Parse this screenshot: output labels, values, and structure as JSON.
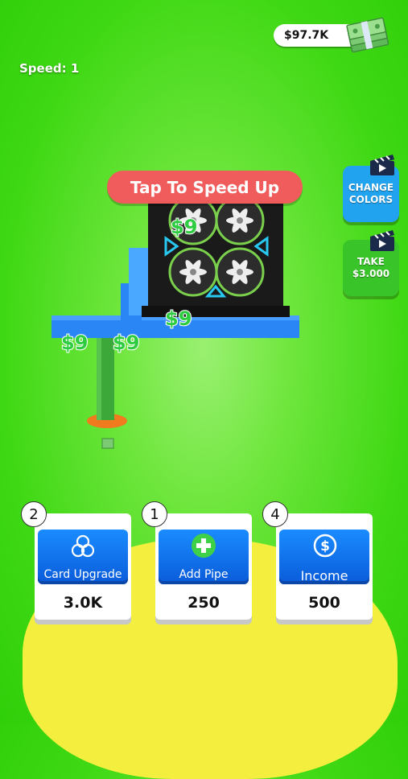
{
  "hud": {
    "money": "$97.7K",
    "speed": "Speed: 1"
  },
  "side_buttons": {
    "change_colors": [
      "CHANGE",
      "COLORS"
    ],
    "take": [
      "TAKE",
      "$3.000"
    ]
  },
  "banner": "Tap To Speed Up",
  "floating_money": [
    "$9",
    "$9",
    "$9",
    "$9"
  ],
  "upgrades": [
    {
      "badge": "2",
      "label": "Card Upgrade",
      "price": "3.0K",
      "icon": "triangle-rings-icon"
    },
    {
      "badge": "1",
      "label": "Add Pipe",
      "price": "250",
      "icon": "plus-icon"
    },
    {
      "badge": "4",
      "label": "Income",
      "price": "500",
      "icon": "dollar-coin-icon"
    }
  ],
  "colors": {
    "background": "#3fd814",
    "platform": "#f4ef3e",
    "card_button": "#1a8cff",
    "banner": "#f05b5b",
    "pipe_blue": "#2a86f5",
    "pipe_green": "#3da83a"
  }
}
